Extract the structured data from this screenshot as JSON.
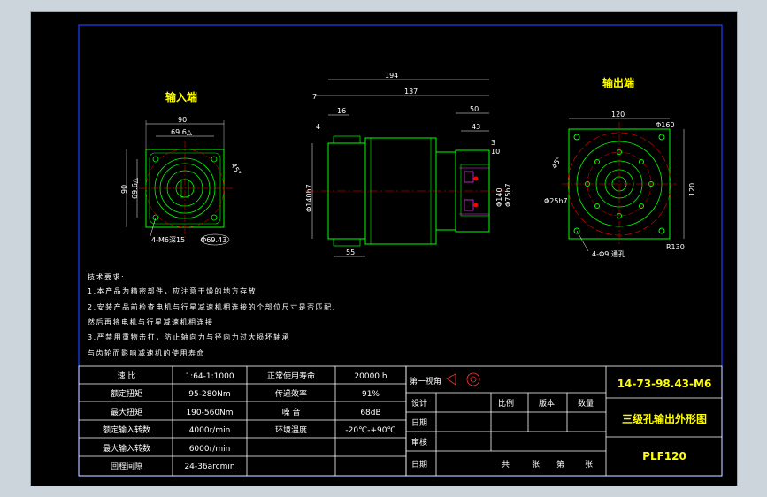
{
  "views": {
    "input_label": "输入端",
    "output_label": "输出端"
  },
  "input_dims": {
    "width": "90",
    "pcd_small": "69.6△",
    "height": "90",
    "side": "69.6△",
    "angle": "45°",
    "thread": "4-M6深15",
    "bore": "Φ69.43"
  },
  "side_dims": {
    "total": "194",
    "left_offset": "7",
    "body": "137",
    "d16": "16",
    "d4": "4",
    "d50": "50",
    "d43": "43",
    "d3": "3",
    "d10": "10",
    "d55": "55",
    "dia_body": "Φ140h7",
    "dia_a": "Φ140",
    "dia_b": "Φ75h7"
  },
  "output_dims": {
    "width": "120",
    "pcd": "Φ160",
    "hole": "Φ25h7",
    "angle": "45°",
    "height": "120",
    "r": "R130",
    "holes": "4-Φ9 通孔"
  },
  "notes": [
    "技术要求:",
    "1.本产品为精密部件，应注意干燥的地方存放",
    "2.安装产品前检查电机与行星减速机相连接的个部位尺寸是否匹配,",
    "然后再将电机与行星减速机相连接",
    "3.严禁用重物击打，防止轴向力与径向力过大损坏轴承",
    "与齿轮而影响减速机的使用寿命"
  ],
  "specs": [
    {
      "label": "速 比",
      "value": "1:64-1:1000",
      "label2": "正常使用寿命",
      "value2": "20000 h"
    },
    {
      "label": "额定扭矩",
      "value": "95-280Nm",
      "label2": "传递效率",
      "value2": "91%"
    },
    {
      "label": "最大扭矩",
      "value": "190-560Nm",
      "label2": "噪 音",
      "value2": "68dB"
    },
    {
      "label": "额定输入转数",
      "value": "4000r/min",
      "label2": "环境温度",
      "value2": "-20℃-+90℃"
    },
    {
      "label": "最大输入转数",
      "value": "6000r/min",
      "label2": "",
      "value2": ""
    },
    {
      "label": "回程间隙",
      "value": "24-36arcmin",
      "label2": "",
      "value2": ""
    }
  ],
  "title_block": {
    "view": "第一视角",
    "rows": [
      "设计",
      "日期",
      "审核",
      "日期"
    ],
    "headers": [
      "比例",
      "版本",
      "数量"
    ],
    "sheet": [
      "共",
      "张",
      "第",
      "张"
    ],
    "drawing_no": "14-73-98.43-M6",
    "title": "三级孔输出外形图",
    "model": "PLF120"
  },
  "colors": {
    "outline": "#00ff00",
    "center": "#ff0000",
    "dimension": "#ffffff",
    "hatch": "#ff00ff",
    "frame": "#0000ff"
  }
}
